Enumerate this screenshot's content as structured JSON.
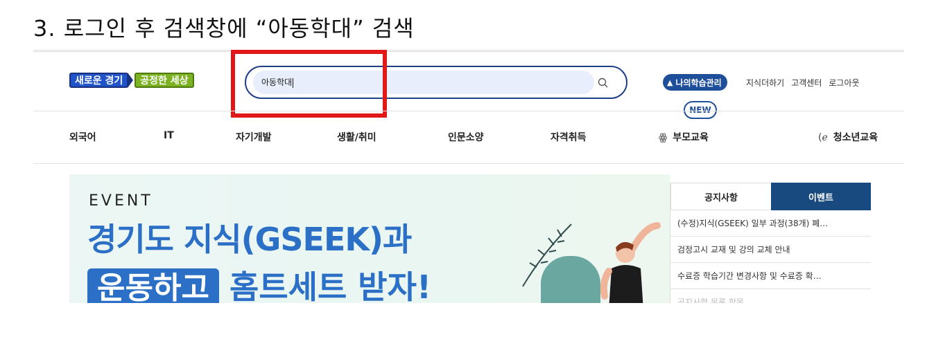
{
  "instruction": {
    "title": "3. 로그인 후 검색창에 “아동학대” 검색"
  },
  "header": {
    "logo": {
      "part1": "새로운 경기",
      "part2": "공정한 세상"
    },
    "search": {
      "value": "아동학대"
    },
    "my_learning_label": "나의학습관리",
    "links": [
      "지식더하기",
      "고객센터",
      "로그아웃"
    ],
    "new_badge": "NEW"
  },
  "nav": {
    "items": [
      "외국어",
      "IT",
      "자기개발",
      "생활/취미",
      "인문소양",
      "자격취득",
      "부모교육",
      "청소년교육"
    ]
  },
  "banner": {
    "tag": "EVENT",
    "line1": "경기도 지식(GSEEK)과",
    "line2_highlight": "운동하고",
    "line2_rest": "홈트세트 받자!"
  },
  "panel": {
    "tabs": [
      "공지사항",
      "이벤트"
    ],
    "active_tab": 1,
    "notices": [
      "(수정)지식(GSEEK) 일부 과정(38개) 폐…",
      "검정고시 교재 및 강의 교체 안내",
      "수료증 학습기간 변경사항 및 수료증 확…",
      "공지사항 목록 항목"
    ]
  },
  "colors": {
    "highlight": "#e01818",
    "brand_blue": "#1e4f9a",
    "banner_blue": "#2b70c6",
    "tab_active": "#18497f"
  }
}
